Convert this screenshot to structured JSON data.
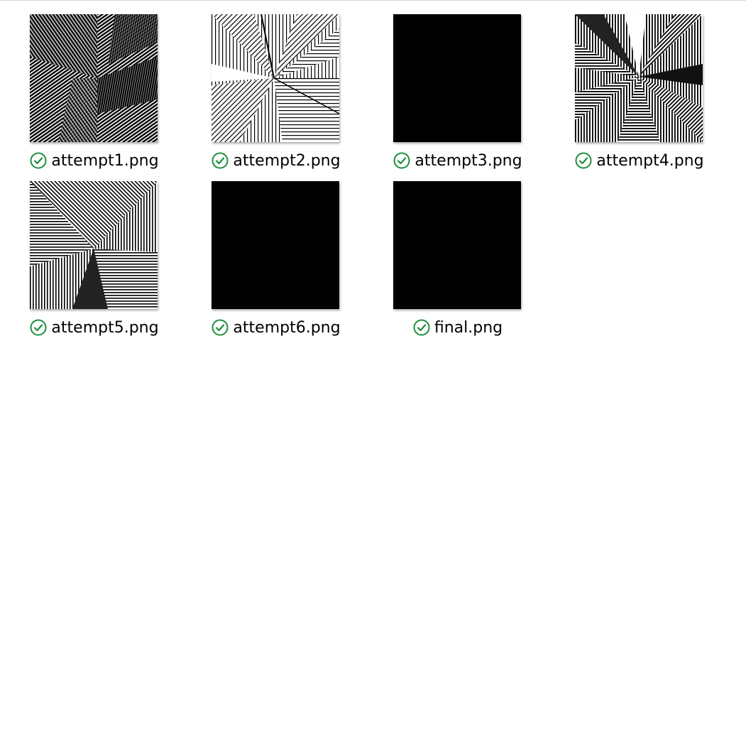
{
  "files": [
    {
      "name": "attempt1.png",
      "status_icon": "sync-ok-check-icon",
      "thumb": "diagonal-mesh"
    },
    {
      "name": "attempt2.png",
      "status_icon": "sync-ok-check-icon",
      "thumb": "radial-light"
    },
    {
      "name": "attempt3.png",
      "status_icon": "sync-ok-check-icon",
      "thumb": "solid-black"
    },
    {
      "name": "attempt4.png",
      "status_icon": "sync-ok-check-icon",
      "thumb": "radial-dark"
    },
    {
      "name": "attempt5.png",
      "status_icon": "sync-ok-check-icon",
      "thumb": "corner-rays"
    },
    {
      "name": "attempt6.png",
      "status_icon": "sync-ok-check-icon",
      "thumb": "solid-black"
    },
    {
      "name": "final.png",
      "status_icon": "sync-ok-check-icon",
      "thumb": "solid-black"
    }
  ],
  "colors": {
    "status_check": "#1e8e3e",
    "background": "#ffffff"
  }
}
